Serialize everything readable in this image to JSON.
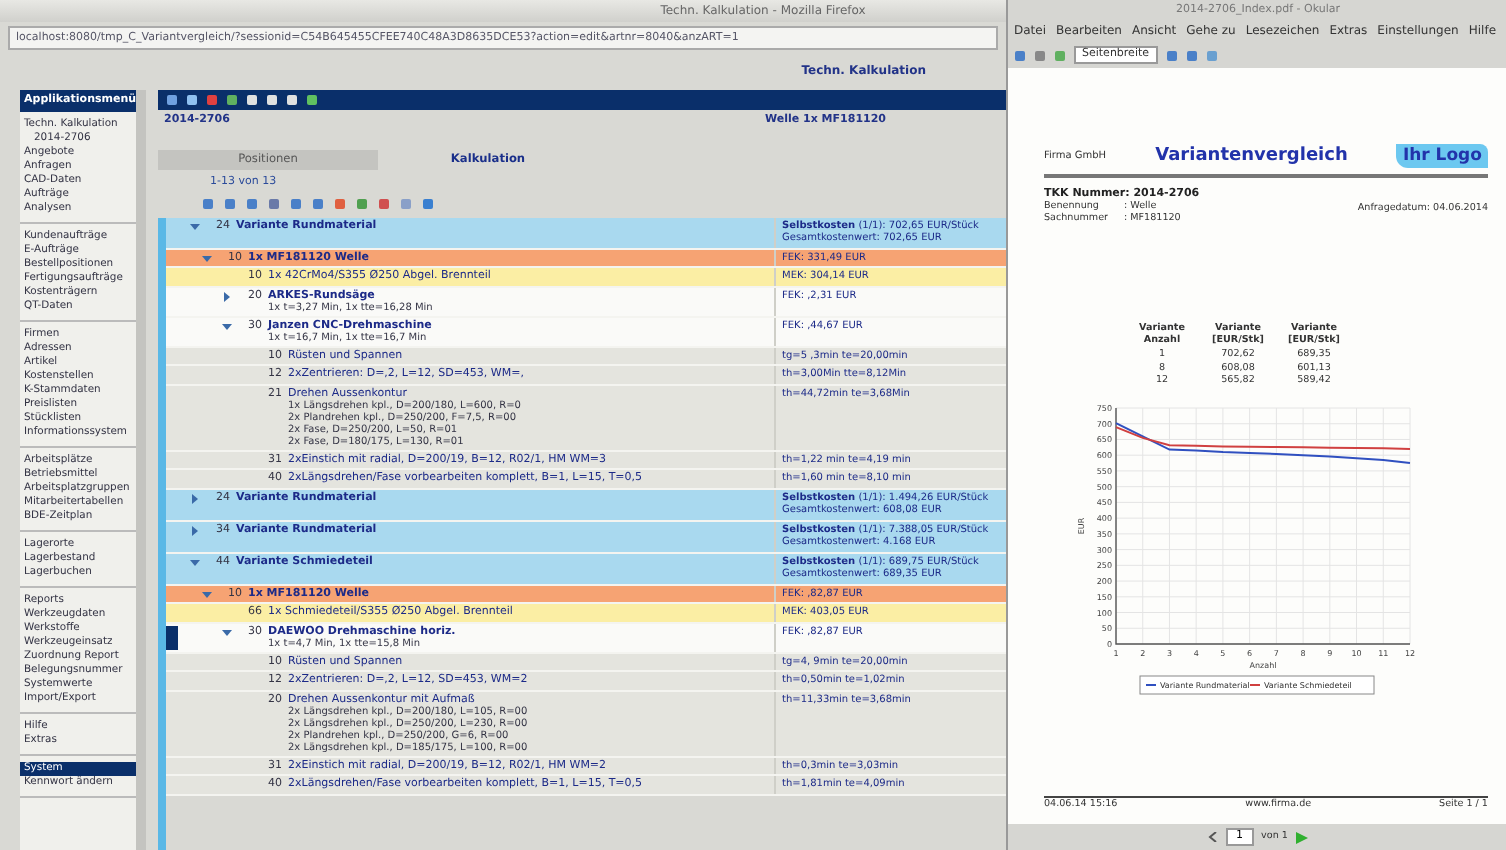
{
  "browser": {
    "title": "Techn. Kalkulation - Mozilla Firefox",
    "url": "localhost:8080/tmp_C_Variantvergleich/?sessionid=C54B645455CFEE740C48A3D8635DCE53?action=edit&artnr=8040&anzART=1",
    "page_title": "Techn. Kalkulation"
  },
  "sidebar": {
    "header": "Applikationsmenü",
    "groups": [
      [
        {
          "label": "Techn. Kalkulation",
          "selected": false,
          "children": [
            {
              "label": "2014-2706",
              "selected": false
            }
          ]
        },
        {
          "label": "Angebote",
          "selected": false
        },
        {
          "label": "Anfragen",
          "selected": false
        },
        {
          "label": "CAD-Daten",
          "selected": false
        },
        {
          "label": "Aufträge",
          "selected": false
        },
        {
          "label": "Analysen",
          "selected": false
        }
      ],
      [
        {
          "label": "Kundenaufträge",
          "selected": false
        },
        {
          "label": "E-Aufträge",
          "selected": false
        },
        {
          "label": "Bestellpositionen",
          "selected": false
        },
        {
          "label": "Fertigungsaufträge",
          "selected": false
        },
        {
          "label": "Kostenträgern",
          "selected": false
        },
        {
          "label": "QT-Daten",
          "selected": false
        }
      ],
      [
        {
          "label": "Firmen",
          "selected": false
        },
        {
          "label": "Adressen",
          "selected": false
        },
        {
          "label": "Artikel",
          "selected": false
        },
        {
          "label": "Kostenstellen",
          "selected": false
        },
        {
          "label": "K-Stammdaten",
          "selected": false
        },
        {
          "label": "Preislisten",
          "selected": false
        },
        {
          "label": "Stücklisten",
          "selected": false
        },
        {
          "label": "Informationssystem",
          "selected": false
        }
      ],
      [
        {
          "label": "Arbeitsplätze",
          "selected": false
        },
        {
          "label": "Betriebsmittel",
          "selected": false
        },
        {
          "label": "Arbeitsplatzgruppen",
          "selected": false
        },
        {
          "label": "Mitarbeitertabellen",
          "selected": false
        },
        {
          "label": "BDE-Zeitplan",
          "selected": false
        }
      ],
      [
        {
          "label": "Lagerorte",
          "selected": false
        },
        {
          "label": "Lagerbestand",
          "selected": false
        },
        {
          "label": "Lagerbuchen",
          "selected": false
        }
      ],
      [
        {
          "label": "Reports",
          "selected": false
        },
        {
          "label": "Werkzeugdaten",
          "selected": false
        },
        {
          "label": "Werkstoffe",
          "selected": false
        },
        {
          "label": "Werkzeugeinsatz",
          "selected": false
        },
        {
          "label": "Zuordnung Report",
          "selected": false
        },
        {
          "label": "Belegungsnummer",
          "selected": false
        },
        {
          "label": "Systemwerte",
          "selected": false
        },
        {
          "label": "Import/Export",
          "selected": false
        }
      ],
      [
        {
          "label": "Hilfe",
          "selected": false
        },
        {
          "label": "Extras",
          "selected": false
        }
      ],
      [
        {
          "label": "System",
          "selected": true
        },
        {
          "label": "Kennwort ändern",
          "selected": false
        }
      ]
    ]
  },
  "record": {
    "number": "2014-2706",
    "info": "Welle 1x MF181120"
  },
  "tabs": [
    {
      "label": "Positionen",
      "selected": false
    },
    {
      "label": "Kalkulation",
      "selected": true
    }
  ],
  "pager": "1-13 von 13",
  "rows": [
    {
      "kind": "group",
      "num": "24",
      "text": "Variante Rundmaterial",
      "expanded": true,
      "selected": false,
      "cost": [
        "**Selbstkosten** (1/1): 702,65 EUR/Stück",
        "Gesamtkostenwert: 702,65 EUR"
      ]
    },
    {
      "kind": "part",
      "num": "10",
      "text": "1x MF181120 Welle",
      "expanded": true,
      "selected": false,
      "cost": [
        "FEK: 331,49 EUR"
      ]
    },
    {
      "kind": "material",
      "num": "10",
      "text": "1x 42CrMo4/S355 Ø250 Abgel. Brennteil",
      "selected": false,
      "cost": [
        "MEK: 304,14 EUR"
      ]
    },
    {
      "kind": "operation",
      "num": "20",
      "text": "ARKES-Rundsäge",
      "sub": "1x t=3,27 Min, 1x tte=16,28 Min",
      "expanded": false,
      "selected": false,
      "cost": [
        "FEK: ,2,31 EUR"
      ]
    },
    {
      "kind": "operation",
      "num": "30",
      "text": "Janzen CNC-Drehmaschine",
      "sub": "1x t=16,7 Min, 1x tte=16,7 Min",
      "expanded": true,
      "selected": false,
      "cost": [
        "FEK: ,44,67 EUR"
      ]
    },
    {
      "kind": "step",
      "num": "10",
      "text": "Rüsten und Spannen",
      "selected": false,
      "cost": [
        "tg=5 ,3min te=20,00min"
      ]
    },
    {
      "kind": "step",
      "num": "12",
      "text": "2xZentrieren: D=,2, L=12, SD=453, WM=,",
      "selected": false,
      "cost": [
        "th=3,00Min tte=8,12Min"
      ]
    },
    {
      "kind": "step",
      "num": "21",
      "text": "Drehen Aussenkontur",
      "sub": "1x Längsdrehen kpl., D=200/180, L=600, R=0\n2x Plandrehen kpl., D=250/200, F=7,5, R=00\n2x Fase, D=250/200, L=50, R=01\n2x Fase, D=180/175, L=130, R=01",
      "selected": false,
      "cost": [
        "th=44,72min te=3,68Min"
      ]
    },
    {
      "kind": "step",
      "num": "31",
      "text": "2xEinstich mit radial, D=200/19, B=12, R02/1, HM WM=3",
      "selected": false,
      "cost": [
        "th=1,22 min te=4,19 min"
      ]
    },
    {
      "kind": "step",
      "num": "40",
      "text": "2xLängsdrehen/Fase vorbearbeiten komplett, B=1, L=15, T=0,5",
      "selected": false,
      "cost": [
        "th=1,60 min te=8,10 min"
      ]
    },
    {
      "kind": "group",
      "num": "24",
      "text": "Variante Rundmaterial",
      "expanded": false,
      "selected": false,
      "cost": [
        "**Selbstkosten** (1/1): 1.494,26 EUR/Stück",
        "Gesamtkostenwert: 608,08 EUR"
      ]
    },
    {
      "kind": "group",
      "num": "34",
      "text": "Variante Rundmaterial",
      "expanded": false,
      "selected": false,
      "cost": [
        "**Selbstkosten** (1/1): 7.388,05 EUR/Stück",
        "Gesamtkostenwert: 4.168 EUR"
      ]
    },
    {
      "kind": "group",
      "num": "44",
      "text": "Variante Schmiedeteil",
      "expanded": true,
      "selected": false,
      "cost": [
        "**Selbstkosten** (1/1): 689,75 EUR/Stück",
        "Gesamtkostenwert: 689,35 EUR"
      ]
    },
    {
      "kind": "part",
      "num": "10",
      "text": "1x MF181120 Welle",
      "expanded": true,
      "selected": false,
      "cost": [
        "FEK: ,82,87 EUR"
      ]
    },
    {
      "kind": "material",
      "num": "66",
      "text": "1x Schmiedeteil/S355 Ø250 Abgel. Brennteil",
      "selected": false,
      "cost": [
        "MEK: 403,05 EUR"
      ]
    },
    {
      "kind": "operation",
      "num": "30",
      "text": "DAEWOO Drehmaschine horiz.",
      "sub": "1x t=4,7 Min, 1x tte=15,8 Min",
      "expanded": true,
      "selected": true,
      "cost": [
        "FEK: ,82,87 EUR"
      ]
    },
    {
      "kind": "step",
      "num": "10",
      "text": "Rüsten und Spannen",
      "selected": false,
      "cost": [
        "tg=4, 9min te=20,00min"
      ]
    },
    {
      "kind": "step",
      "num": "12",
      "text": "2xZentrieren: D=,2, L=12, SD=453, WM=2",
      "selected": false,
      "cost": [
        "th=0,50min te=1,02min"
      ]
    },
    {
      "kind": "step",
      "num": "20",
      "text": "Drehen Aussenkontur mit Aufmaß",
      "sub": "2x Längsdrehen kpl., D=200/180, L=105, R=00\n2x Längsdrehen kpl., D=250/200, L=230, R=00\n2x Plandrehen kpl., D=250/200, G=6, R=00\n2x Längsdrehen kpl., D=185/175, L=100, R=00",
      "selected": false,
      "cost": [
        "th=11,33min te=3,68min"
      ]
    },
    {
      "kind": "step",
      "num": "31",
      "text": "2xEinstich mit radial, D=200/19, B=12, R02/1, HM WM=2",
      "selected": false,
      "cost": [
        "th=0,3min te=3,03min"
      ]
    },
    {
      "kind": "step",
      "num": "40",
      "text": "2xLängsdrehen/Fase vorbearbeiten komplett, B=1, L=15, T=0,5",
      "selected": false,
      "cost": [
        "th=1,81min te=4,09min"
      ]
    }
  ],
  "viewer": {
    "title": "2014-2706_Index.pdf - Okular",
    "menu": [
      "Datei",
      "Bearbeiten",
      "Ansicht",
      "Gehe zu",
      "Lesezeichen",
      "Extras",
      "Einstellungen",
      "Hilfe"
    ],
    "zoom": "Seitenbreite",
    "doc": {
      "company": "Firma GmbH",
      "heading": "Variantenvergleich",
      "logo": "Ihr Logo",
      "number": "TKK Nummer: 2014-2706",
      "fields": [
        {
          "label": "Benennung",
          "value": ": Welle"
        },
        {
          "label": "Sachnummer",
          "value": ": MF181120"
        }
      ],
      "date": "Anfragedatum: 04.06.2014",
      "table": {
        "columns": [
          "Variante Anzahl",
          "Variante [EUR/Stk]",
          "Variante [EUR/Stk]"
        ],
        "rows": [
          [
            "1",
            "702,62",
            "689,35"
          ],
          [
            "8",
            "608,08",
            "601,13"
          ],
          [
            "12",
            "565,82",
            "589,42"
          ]
        ]
      },
      "chart_data": {
        "type": "line",
        "xlabel": "Anzahl",
        "ylabel": "EUR",
        "x": [
          1,
          2,
          3,
          4,
          5,
          6,
          7,
          8,
          9,
          10,
          11,
          12
        ],
        "series": [
          {
            "name": "Variante Rundmaterial",
            "color": "#3050c0",
            "values": [
              702,
              660,
              618,
              615,
              610,
              607,
              604,
              600,
              596,
              590,
              585,
              575
            ]
          },
          {
            "name": "Variante Schmiedeteil",
            "color": "#d04040",
            "values": [
              689,
              655,
              632,
              630,
              628,
              627,
              626,
              625,
              624,
              623,
              622,
              620
            ]
          }
        ],
        "xlim": [
          1,
          12
        ],
        "ylim": [
          0,
          750
        ],
        "grid": true,
        "legend": "bottom",
        "yticks": [
          0,
          50,
          100,
          150,
          200,
          250,
          300,
          350,
          400,
          450,
          500,
          550,
          600,
          650,
          700,
          750
        ],
        "xticks": [
          1,
          2,
          3,
          4,
          5,
          6,
          7,
          8,
          9,
          10,
          11,
          12
        ]
      },
      "footer": [
        "04.06.14 15:16",
        "www.firma.de",
        "Seite 1 / 1"
      ]
    },
    "page": "1",
    "page_total": "von 1"
  }
}
